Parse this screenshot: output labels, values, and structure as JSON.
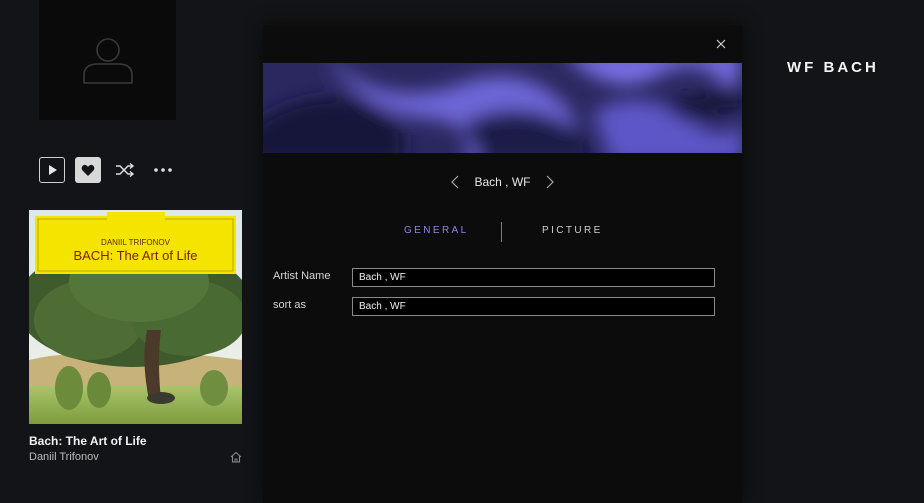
{
  "artist": {
    "header_name": "WF BACH"
  },
  "controls": {
    "play_icon": "play-icon",
    "favorite_icon": "heart-icon",
    "shuffle_icon": "shuffle-icon",
    "more_icon": "more-icon"
  },
  "album": {
    "cover_label": "DANIIL TRIFONOV",
    "cover_title": "BACH: The Art of Life",
    "title": "Bach: The Art of Life",
    "artist": "Daniil Trifonov",
    "home_icon": "home-icon"
  },
  "dialog": {
    "close_icon": "close-icon",
    "nav": {
      "prev_icon": "chevron-left-icon",
      "name": "Bach , WF",
      "next_icon": "chevron-right-icon"
    },
    "tabs": [
      {
        "label": "GENERAL",
        "active": true
      },
      {
        "label": "PICTURE",
        "active": false
      }
    ],
    "fields": {
      "artist_name_label": "Artist Name",
      "artist_name_value": "Bach , WF",
      "sort_as_label": "sort as",
      "sort_as_value": "Bach , WF"
    }
  },
  "colors": {
    "accent": "#8a86e6",
    "background": "#131417",
    "dialog_bg": "#0c0c0d",
    "cover_yellow": "#f5e400"
  }
}
